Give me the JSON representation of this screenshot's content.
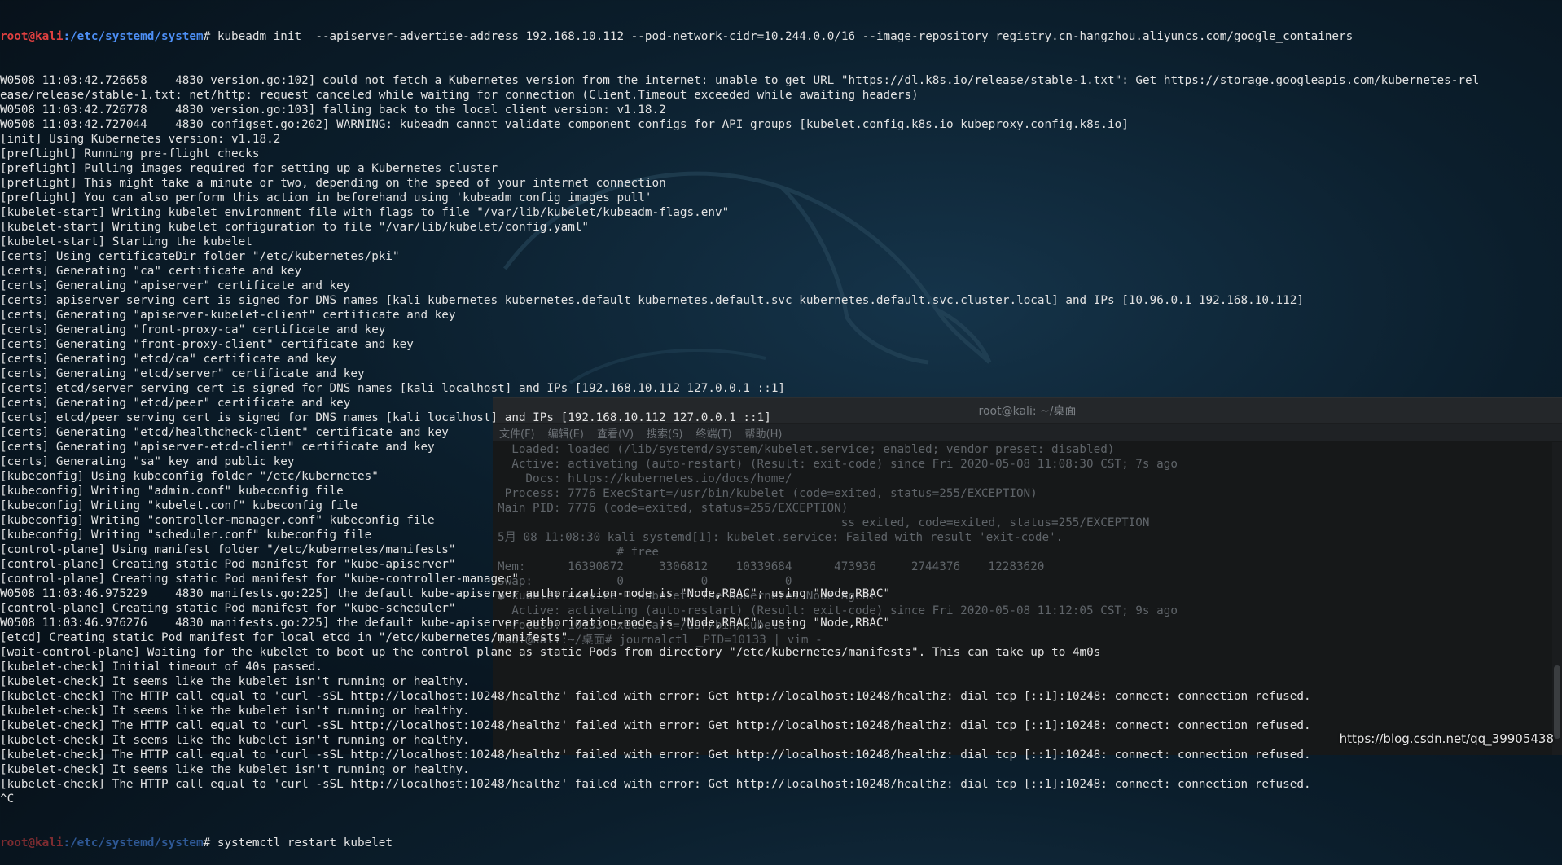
{
  "colors": {
    "prompt_user": "#e04040",
    "prompt_path": "#4d8ff5",
    "text": "#e2e2e2"
  },
  "background_window": {
    "title": "root@kali: ~/桌面",
    "menu": [
      "文件(F)",
      "编辑(E)",
      "查看(V)",
      "搜索(S)",
      "终端(T)",
      "帮助(H)"
    ],
    "lines": [
      "  Loaded: loaded (/lib/systemd/system/kubelet.service; enabled; vendor preset: disabled)",
      "  Active: activating (auto-restart) (Result: exit-code) since Fri 2020-05-08 11:08:30 CST; 7s ago",
      "    Docs: https://kubernetes.io/docs/home/",
      " Process: 7776 ExecStart=/usr/bin/kubelet (code=exited, status=255/EXCEPTION)",
      "Main PID: 7776 (code=exited, status=255/EXCEPTION)",
      "",
      "                                                 ss exited, code=exited, status=255/EXCEPTION",
      "5月 08 11:08:30 kali systemd[1]: kubelet.service: Failed with result 'exit-code'.",
      "                 # free",
      "Mem:      16390872     3306812    10339684      473936     2744376    12283620",
      "Swap:            0           0           0",
      "● kubelet.service - kubelet: The Kubernetes Node Agent",
      "",
      "  Active: activating (auto-restart) (Result: exit-code) since Fri 2020-05-08 11:12:05 CST; 9s ago",
      "",
      " Process: 10133 ExecStart=/usr/bin/kubelet",
      "root@kali:~/桌面# journalctl _PID=10133 | vim -"
    ]
  },
  "terminal": {
    "prompt_user": "root@kali",
    "prompt_path": ":/etc/systemd/system",
    "command": "# kubeadm init  --apiserver-advertise-address 192.168.10.112 --pod-network-cidr=10.244.0.0/16 --image-repository registry.cn-hangzhou.aliyuncs.com/google_containers",
    "lines": [
      "W0508 11:03:42.726658    4830 version.go:102] could not fetch a Kubernetes version from the internet: unable to get URL \"https://dl.k8s.io/release/stable-1.txt\": Get https://storage.googleapis.com/kubernetes-rel",
      "ease/release/stable-1.txt: net/http: request canceled while waiting for connection (Client.Timeout exceeded while awaiting headers)",
      "W0508 11:03:42.726778    4830 version.go:103] falling back to the local client version: v1.18.2",
      "W0508 11:03:42.727044    4830 configset.go:202] WARNING: kubeadm cannot validate component configs for API groups [kubelet.config.k8s.io kubeproxy.config.k8s.io]",
      "[init] Using Kubernetes version: v1.18.2",
      "[preflight] Running pre-flight checks",
      "[preflight] Pulling images required for setting up a Kubernetes cluster",
      "[preflight] This might take a minute or two, depending on the speed of your internet connection",
      "[preflight] You can also perform this action in beforehand using 'kubeadm config images pull'",
      "[kubelet-start] Writing kubelet environment file with flags to file \"/var/lib/kubelet/kubeadm-flags.env\"",
      "[kubelet-start] Writing kubelet configuration to file \"/var/lib/kubelet/config.yaml\"",
      "[kubelet-start] Starting the kubelet",
      "[certs] Using certificateDir folder \"/etc/kubernetes/pki\"",
      "[certs] Generating \"ca\" certificate and key",
      "[certs] Generating \"apiserver\" certificate and key",
      "[certs] apiserver serving cert is signed for DNS names [kali kubernetes kubernetes.default kubernetes.default.svc kubernetes.default.svc.cluster.local] and IPs [10.96.0.1 192.168.10.112]",
      "[certs] Generating \"apiserver-kubelet-client\" certificate and key",
      "[certs] Generating \"front-proxy-ca\" certificate and key",
      "[certs] Generating \"front-proxy-client\" certificate and key",
      "[certs] Generating \"etcd/ca\" certificate and key",
      "[certs] Generating \"etcd/server\" certificate and key",
      "[certs] etcd/server serving cert is signed for DNS names [kali localhost] and IPs [192.168.10.112 127.0.0.1 ::1]",
      "[certs] Generating \"etcd/peer\" certificate and key",
      "[certs] etcd/peer serving cert is signed for DNS names [kali localhost] and IPs [192.168.10.112 127.0.0.1 ::1]",
      "[certs] Generating \"etcd/healthcheck-client\" certificate and key",
      "[certs] Generating \"apiserver-etcd-client\" certificate and key",
      "[certs] Generating \"sa\" key and public key",
      "[kubeconfig] Using kubeconfig folder \"/etc/kubernetes\"",
      "[kubeconfig] Writing \"admin.conf\" kubeconfig file",
      "[kubeconfig] Writing \"kubelet.conf\" kubeconfig file",
      "[kubeconfig] Writing \"controller-manager.conf\" kubeconfig file",
      "[kubeconfig] Writing \"scheduler.conf\" kubeconfig file",
      "[control-plane] Using manifest folder \"/etc/kubernetes/manifests\"",
      "[control-plane] Creating static Pod manifest for \"kube-apiserver\"",
      "[control-plane] Creating static Pod manifest for \"kube-controller-manager\"",
      "W0508 11:03:46.975229    4830 manifests.go:225] the default kube-apiserver authorization-mode is \"Node,RBAC\"; using \"Node,RBAC\"",
      "[control-plane] Creating static Pod manifest for \"kube-scheduler\"",
      "W0508 11:03:46.976276    4830 manifests.go:225] the default kube-apiserver authorization-mode is \"Node,RBAC\"; using \"Node,RBAC\"",
      "[etcd] Creating static Pod manifest for local etcd in \"/etc/kubernetes/manifests\"",
      "[wait-control-plane] Waiting for the kubelet to boot up the control plane as static Pods from directory \"/etc/kubernetes/manifests\". This can take up to 4m0s",
      "[kubelet-check] Initial timeout of 40s passed.",
      "[kubelet-check] It seems like the kubelet isn't running or healthy.",
      "[kubelet-check] The HTTP call equal to 'curl -sSL http://localhost:10248/healthz' failed with error: Get http://localhost:10248/healthz: dial tcp [::1]:10248: connect: connection refused.",
      "[kubelet-check] It seems like the kubelet isn't running or healthy.",
      "[kubelet-check] The HTTP call equal to 'curl -sSL http://localhost:10248/healthz' failed with error: Get http://localhost:10248/healthz: dial tcp [::1]:10248: connect: connection refused.",
      "[kubelet-check] It seems like the kubelet isn't running or healthy.",
      "[kubelet-check] The HTTP call equal to 'curl -sSL http://localhost:10248/healthz' failed with error: Get http://localhost:10248/healthz: dial tcp [::1]:10248: connect: connection refused.",
      "[kubelet-check] It seems like the kubelet isn't running or healthy.",
      "[kubelet-check] The HTTP call equal to 'curl -sSL http://localhost:10248/healthz' failed with error: Get http://localhost:10248/healthz: dial tcp [::1]:10248: connect: connection refused.",
      "^C"
    ],
    "last_prompt_user": "root@kali",
    "last_prompt_path": ":/etc/systemd/system",
    "last_command": "# systemctl restart kubelet"
  },
  "watermark": "https://blog.csdn.net/qq_39905438"
}
